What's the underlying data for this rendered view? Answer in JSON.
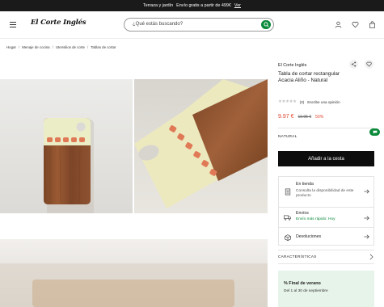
{
  "promo": {
    "text": "Terraza y jardín",
    "offer": "Envío gratis a partir de 499€",
    "link": "Ver"
  },
  "header": {
    "logo": "El Corte Inglés",
    "search_placeholder": "¿Qué estás buscando?",
    "icons": [
      "menu-icon",
      "search-icon",
      "user-icon",
      "heart-icon",
      "bag-icon"
    ]
  },
  "breadcrumb": [
    "Hogar",
    "Menaje de cocina",
    "Utensilios de corte",
    "Tablas de cortar"
  ],
  "product": {
    "brand": "El Corte Inglés",
    "title": "Tabla de cortar rectangular Acacia Aliño - Natural",
    "stars": "★★★★★",
    "rating_count": "(0)",
    "review_link": "Escribe una opinión",
    "price": "9.97 €",
    "old_price": "19.95 €",
    "discount": "50%",
    "color": "NATURAL",
    "add_to_cart": "Añadir a la cesta"
  },
  "services": {
    "store_title": "En tienda",
    "store_desc": "Consulta la disponibilidad de este producto",
    "shipping_title": "Envíos",
    "shipping_desc": "Envío más rápido: Hoy",
    "returns_title": "Devoluciones"
  },
  "features_label": "CARACTERÍSTICAS",
  "promo_banner": {
    "title": "% Final de verano",
    "dates": "Del 1 al 30 de septiembre"
  },
  "colors": {
    "price": "#e0462f",
    "brand_green": "#0a8a3a",
    "button": "#0d0d0d",
    "banner": "#e7f4ea"
  }
}
